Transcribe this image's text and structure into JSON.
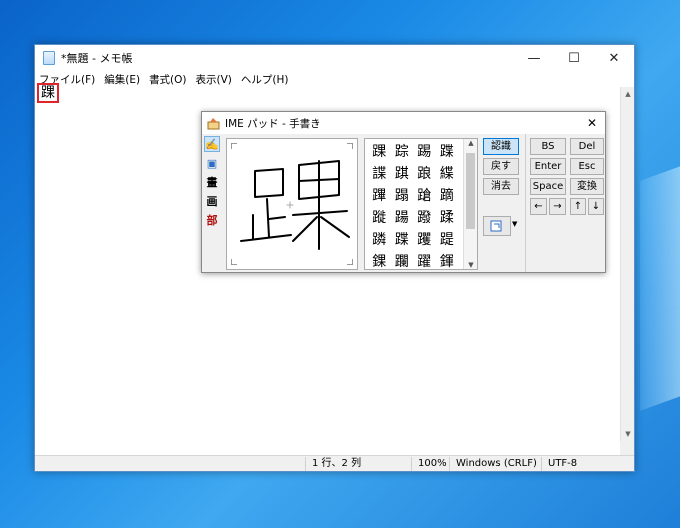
{
  "notepad": {
    "title": "*無題 - メモ帳",
    "menu": [
      "ファイル(F)",
      "編集(E)",
      "書式(O)",
      "表示(V)",
      "ヘルプ(H)"
    ],
    "content_char": "踝",
    "window_buttons": {
      "minimize": "—",
      "maximize": "☐",
      "close": "✕"
    },
    "status": {
      "position": "1 行、2 列",
      "zoom": "100%",
      "line_ending": "Windows (CRLF)",
      "encoding": "UTF-8"
    }
  },
  "ime": {
    "title": "IME パッド - 手書き",
    "close": "✕",
    "tools": [
      "✍",
      "▣",
      "畫",
      "画",
      "部"
    ],
    "candidates": [
      "踝",
      "踪",
      "踢",
      "蹀",
      "諜",
      "踑",
      "踉",
      "緤",
      "蹕",
      "蹋",
      "蹌",
      "蹢",
      "蹝",
      "踼",
      "蹳",
      "蹂",
      "蹸",
      "蹀",
      "躩",
      "踶",
      "錁",
      "躝",
      "躍",
      "鍕"
    ],
    "actions": {
      "recognize": "認識",
      "undo": "戻す",
      "clear": "消去"
    },
    "keys": {
      "bs": "BS",
      "del": "Del",
      "enter": "Enter",
      "esc": "Esc",
      "space": "Space",
      "convert": "変換",
      "left": "←",
      "right": "→",
      "up": "↑",
      "down": "↓"
    },
    "colors": {
      "highlight": "#e0242c",
      "accent": "#0078d7"
    }
  }
}
